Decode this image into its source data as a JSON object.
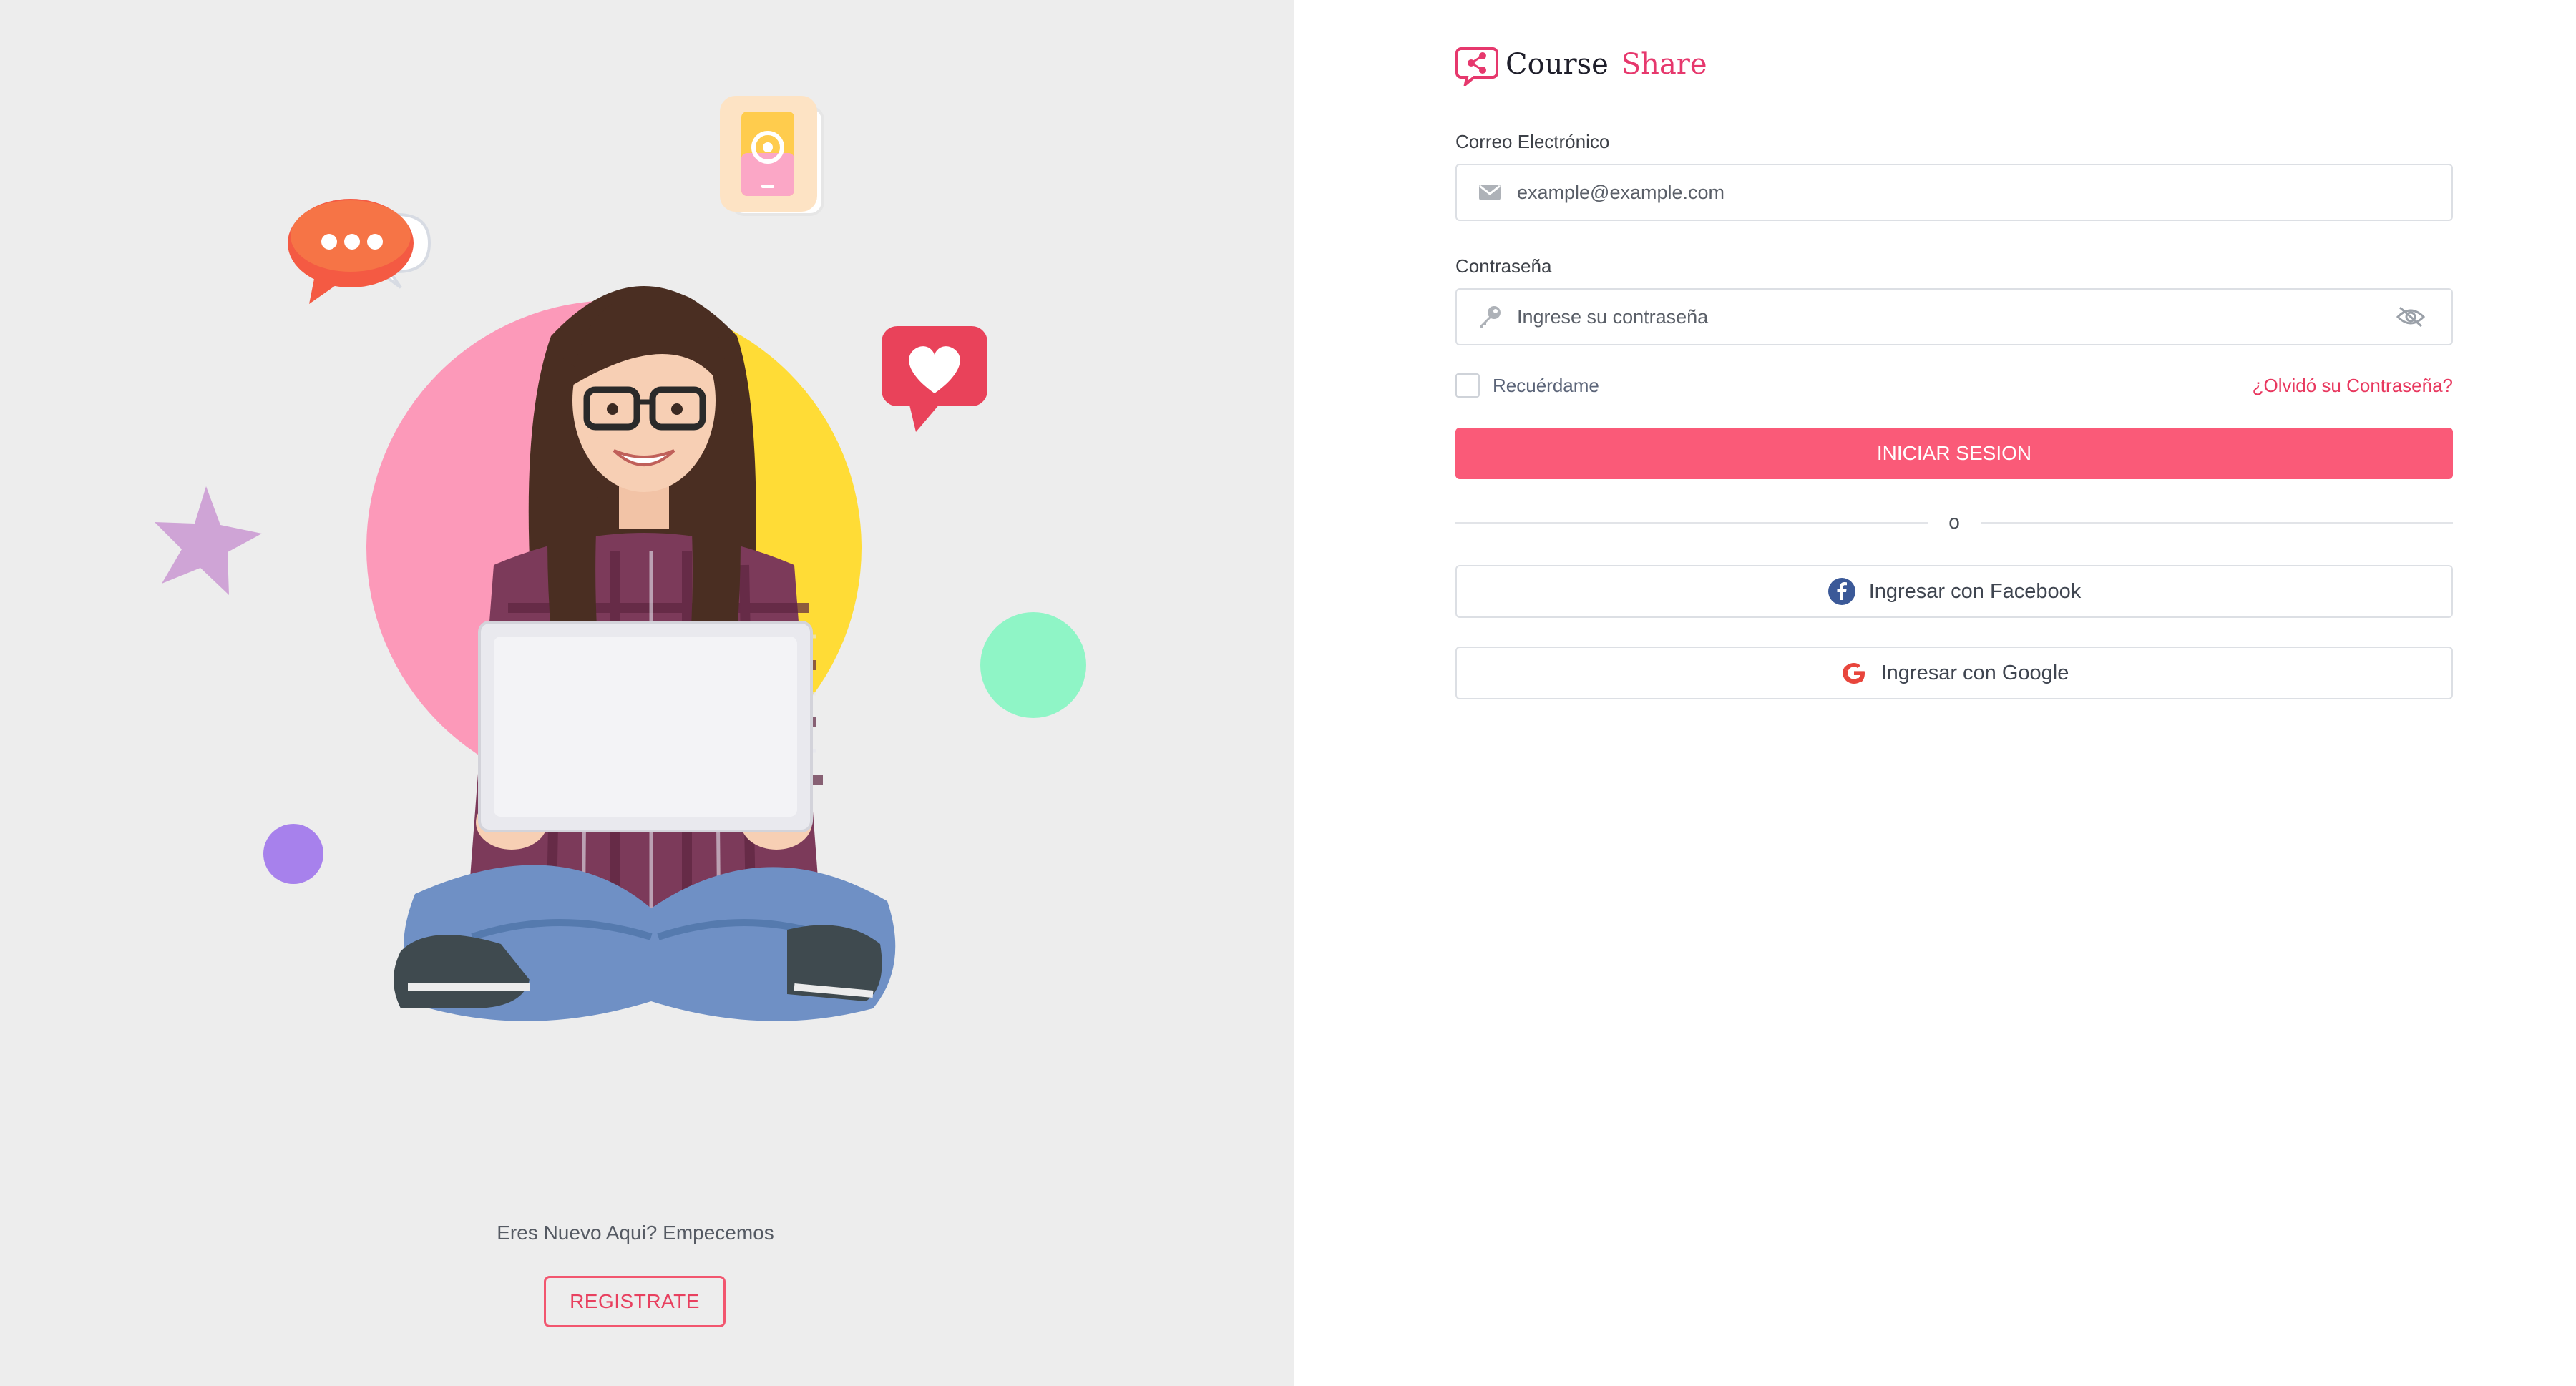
{
  "left_panel": {
    "signup_prompt": "Eres Nuevo Aqui? Empecemos",
    "register_label": "REGISTRATE"
  },
  "brand": {
    "name_part1": "Course",
    "name_part2": "Share",
    "accent_color": "#e6386d"
  },
  "form": {
    "email_label": "Correo Electrónico",
    "email_placeholder": "example@example.com",
    "email_icon": "envelope-icon",
    "password_label": "Contraseña",
    "password_placeholder": "Ingrese su contraseña",
    "password_icon": "key-icon",
    "password_toggle_icon": "eye-slash-icon",
    "remember_label": "Recuérdame",
    "remember_checked": false,
    "forgot_label": "¿Olvidó su Contraseña?",
    "submit_label": "INICIAR SESION",
    "submit_color": "#fa5a78",
    "divider_label": "o"
  },
  "social": {
    "facebook_label": "Ingresar con Facebook",
    "facebook_icon": "facebook-icon",
    "google_label": "Ingresar con Google",
    "google_icon": "google-icon"
  }
}
